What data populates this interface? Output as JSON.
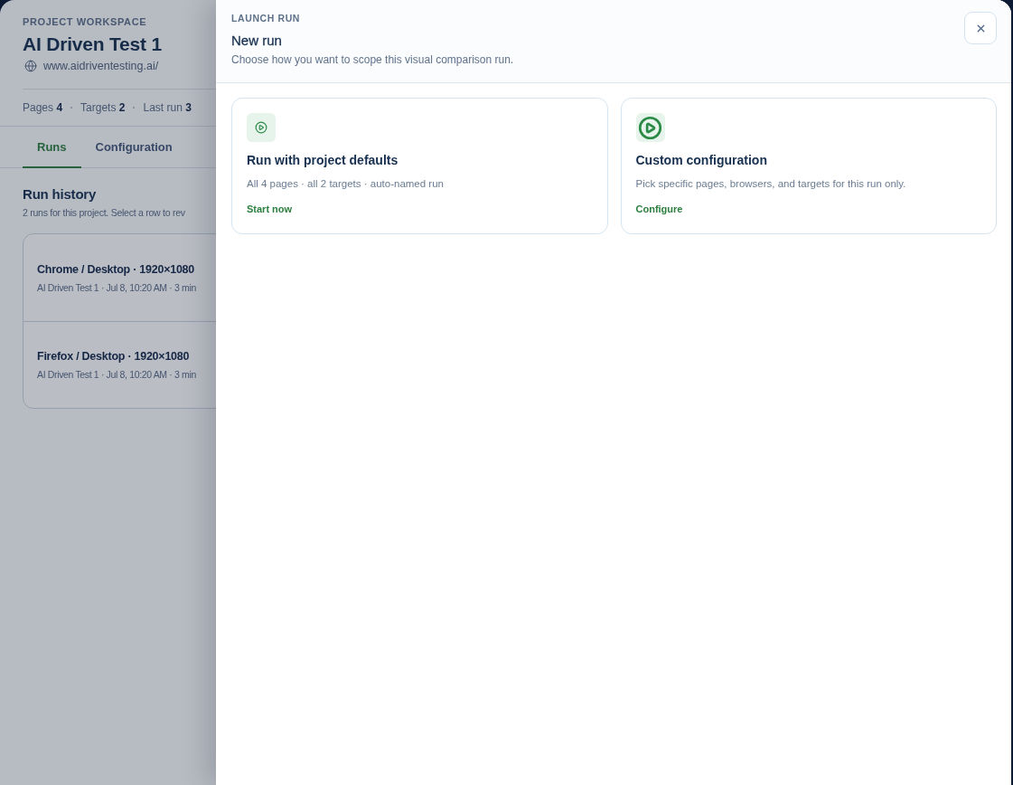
{
  "workspace": {
    "eyebrow": "PROJECT WORKSPACE",
    "title": "AI Driven Test 1",
    "url": "www.aidriventesting.ai/",
    "stats": [
      {
        "label": "Pages",
        "value": "4"
      },
      {
        "label": "Targets",
        "value": "2"
      },
      {
        "label": "Last run",
        "value": "3"
      }
    ],
    "tabs": [
      {
        "label": "Runs",
        "selected": true
      },
      {
        "label": "Configuration",
        "selected": false
      }
    ],
    "run_history": {
      "title": "Run history",
      "subtitle": "2 runs for this project. Select a row to rev",
      "rows": [
        {
          "title": "Chrome / Desktop · 1920×1080",
          "meta": "AI Driven Test 1 · Jul 8, 10:20 AM · 3 min"
        },
        {
          "title": "Firefox / Desktop · 1920×1080",
          "meta": "AI Driven Test 1 · Jul 8, 10:20 AM · 3 min"
        }
      ]
    }
  },
  "drawer": {
    "eyebrow": "LAUNCH RUN",
    "title": "New run",
    "subtitle": "Choose how you want to scope this visual comparison run.",
    "options": [
      {
        "kind": "defaults",
        "title": "Run with project defaults",
        "description": "All 4 pages · all 2 targets · auto-named run",
        "action": "Start now"
      },
      {
        "kind": "custom",
        "title": "Custom configuration",
        "description": "Pick specific pages, browsers, and targets for this run only.",
        "action": "Configure"
      }
    ]
  }
}
